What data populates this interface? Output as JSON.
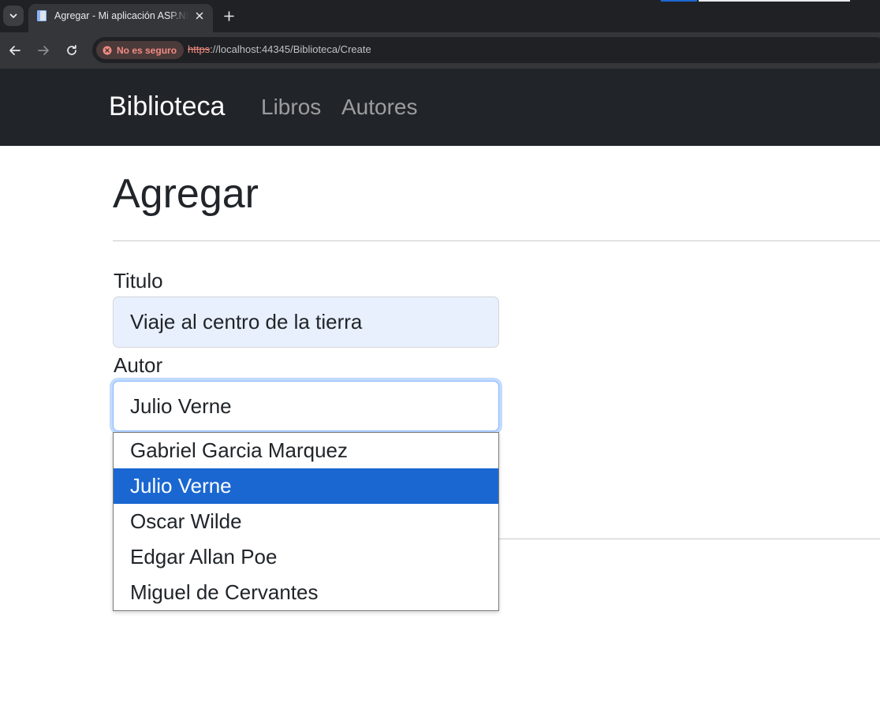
{
  "browser": {
    "tab_title": "Agregar - Mi aplicación ASP.NET",
    "security_label": "No es seguro",
    "url_scheme": "https",
    "url_rest": "://localhost:44345/Biblioteca/Create",
    "icons": [
      "chevron-down-icon",
      "document-icon",
      "close-icon",
      "plus-icon",
      "back-arrow-icon",
      "forward-arrow-icon",
      "reload-icon",
      "warning-icon"
    ]
  },
  "navbar": {
    "brand": "Biblioteca",
    "links": [
      {
        "label": "Libros"
      },
      {
        "label": "Autores"
      }
    ]
  },
  "page": {
    "title": "Agregar"
  },
  "form": {
    "titulo_label": "Titulo",
    "titulo_value": "Viaje al centro de la tierra",
    "autor_label": "Autor",
    "autor_selected": "Julio Verne",
    "autor_options": [
      {
        "label": "Gabriel Garcia Marquez",
        "selected": false
      },
      {
        "label": "Julio Verne",
        "selected": true
      },
      {
        "label": "Oscar Wilde",
        "selected": false
      },
      {
        "label": "Edgar Allan Poe",
        "selected": false
      },
      {
        "label": "Miguel de Cervantes",
        "selected": false
      }
    ]
  },
  "colors": {
    "navbar_bg": "#212529",
    "selected_option_bg": "#1a67d2",
    "autofill_bg": "#e8f0fe",
    "insecure_red": "#f28b82"
  }
}
